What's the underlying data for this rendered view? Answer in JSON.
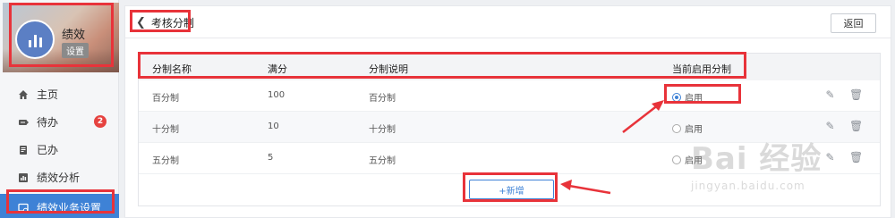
{
  "sidebar": {
    "profile": {
      "name": "绩效",
      "tag": "设置"
    },
    "items": [
      {
        "label": "主页",
        "icon": "home-icon"
      },
      {
        "label": "待办",
        "icon": "todo-icon",
        "badge": "2"
      },
      {
        "label": "已办",
        "icon": "done-icon"
      },
      {
        "label": "绩效分析",
        "icon": "chart-icon"
      },
      {
        "label": "绩效业务设置",
        "icon": "settings-monitor-icon",
        "active": true
      }
    ]
  },
  "header": {
    "back_label": "考核分制",
    "return_label": "返回"
  },
  "table": {
    "columns": [
      "分制名称",
      "满分",
      "分制说明",
      "当前启用分制"
    ],
    "rows": [
      {
        "name": "百分制",
        "full": "100",
        "desc": "百分制",
        "status": "启用",
        "selected": true
      },
      {
        "name": "十分制",
        "full": "10",
        "desc": "十分制",
        "status": "启用",
        "selected": false
      },
      {
        "name": "五分制",
        "full": "5",
        "desc": "五分制",
        "status": "启用",
        "selected": false
      }
    ]
  },
  "add_label": "+新增",
  "watermark": {
    "big": "Bai 经验",
    "small": "jingyan.baidu.com"
  },
  "colors": {
    "accent": "#3e82d6",
    "highlight": "#e8333a",
    "badge": "#e64340"
  }
}
